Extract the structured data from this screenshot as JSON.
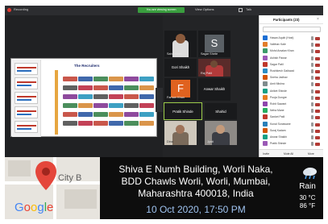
{
  "topbar": {
    "recording_label": "Recording",
    "host_label": "You are viewing screen",
    "view_options_label": "View Options",
    "right_label": "Talk"
  },
  "shared_slide": {
    "title": "The Recruiters"
  },
  "gallery": {
    "tiles": [
      {
        "label": "Sahil Khan"
      },
      {
        "label": "Sagar Shete"
      },
      {
        "name": "Gori Shaikh"
      },
      {
        "label": "Raj Patil"
      },
      {
        "initial": "F",
        "label": "Farhan Khan"
      },
      {
        "name": "Anwar Shaikh"
      },
      {
        "name": "Pratik Shinde"
      },
      {
        "name": "Shahid"
      },
      {
        "label": "Dina"
      },
      {
        "label": "Jyoti"
      }
    ],
    "avatar_s": "S"
  },
  "participants": {
    "title": "Participants (23)",
    "close_glyph": "×",
    "items": [
      {
        "name": "Hasan Aquib (Host)",
        "color": "#1d6fd4"
      },
      {
        "name": "Vaibhav Kale",
        "color": "#e27d2a"
      },
      {
        "name": "Mohd Arsalan Khan",
        "color": "#3b9b6a"
      },
      {
        "name": "Ashish Pawar",
        "color": "#9b59b6"
      },
      {
        "name": "Sagar Patil",
        "color": "#c0392b"
      },
      {
        "name": "Rushikesh Gaikwad",
        "color": "#2a8cc4"
      },
      {
        "name": "Sneha Jadhav",
        "color": "#d35400"
      },
      {
        "name": "Amit Mishra",
        "color": "#7f8c8d"
      },
      {
        "name": "Aniket Shinde",
        "color": "#16a085"
      },
      {
        "name": "Pooja Dongre",
        "color": "#e67e22"
      },
      {
        "name": "Rohit Sawant",
        "color": "#8e44ad"
      },
      {
        "name": "Neha Mane",
        "color": "#27ae60"
      },
      {
        "name": "Sanket Patil",
        "color": "#c0392b"
      },
      {
        "name": "Kunal Sonawane",
        "color": "#2980b9"
      },
      {
        "name": "Suraj Kadam",
        "color": "#d35400"
      },
      {
        "name": "Anwar Shaikh",
        "color": "#16a085"
      },
      {
        "name": "Pratik Shinde",
        "color": "#9b59b6"
      }
    ],
    "footer": {
      "invite": "Invite",
      "mute_all": "Mute All",
      "more": "More"
    }
  },
  "location": {
    "map_label": "City B",
    "logo_letters": [
      {
        "ch": "G",
        "color": "#4285F4"
      },
      {
        "ch": "o",
        "color": "#EA4335"
      },
      {
        "ch": "o",
        "color": "#FBBC05"
      },
      {
        "ch": "g",
        "color": "#4285F4"
      },
      {
        "ch": "l",
        "color": "#34A853"
      },
      {
        "ch": "e",
        "color": "#EA4335"
      }
    ],
    "address_line1": "Shiva E Numh Building, Worli Naka,",
    "address_line2": "BDD Chawls Worli, Worli, Mumbai,",
    "address_line3": "Maharashtra 400018, India",
    "datetime": "10 Oct 2020, 17:50 PM",
    "weather": {
      "condition": "Rain",
      "temp_c": "30 °C",
      "temp_f": "86 °F"
    }
  }
}
